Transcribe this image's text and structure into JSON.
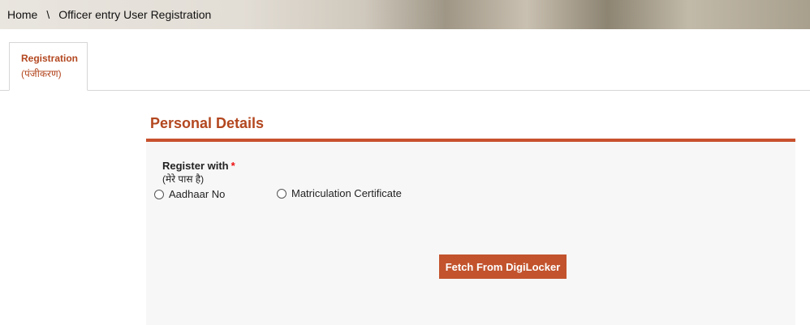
{
  "breadcrumb": {
    "home": "Home",
    "separator": "\\",
    "current": "Officer entry User Registration"
  },
  "tabs": [
    {
      "label": "Registration",
      "sub_label": "(पंजीकरण)"
    }
  ],
  "section": {
    "title": "Personal Details",
    "register_with_label": "Register with",
    "required_mark": "*",
    "register_with_sub": "(मेरे पास है)",
    "options": [
      {
        "label": "Aadhaar No",
        "selected": false
      },
      {
        "label": "Matriculation Certificate",
        "selected": false
      }
    ],
    "fetch_button": "Fetch From DigiLocker"
  },
  "colors": {
    "accent": "#b3471f",
    "button": "#c2532d",
    "required": "#e11111"
  }
}
